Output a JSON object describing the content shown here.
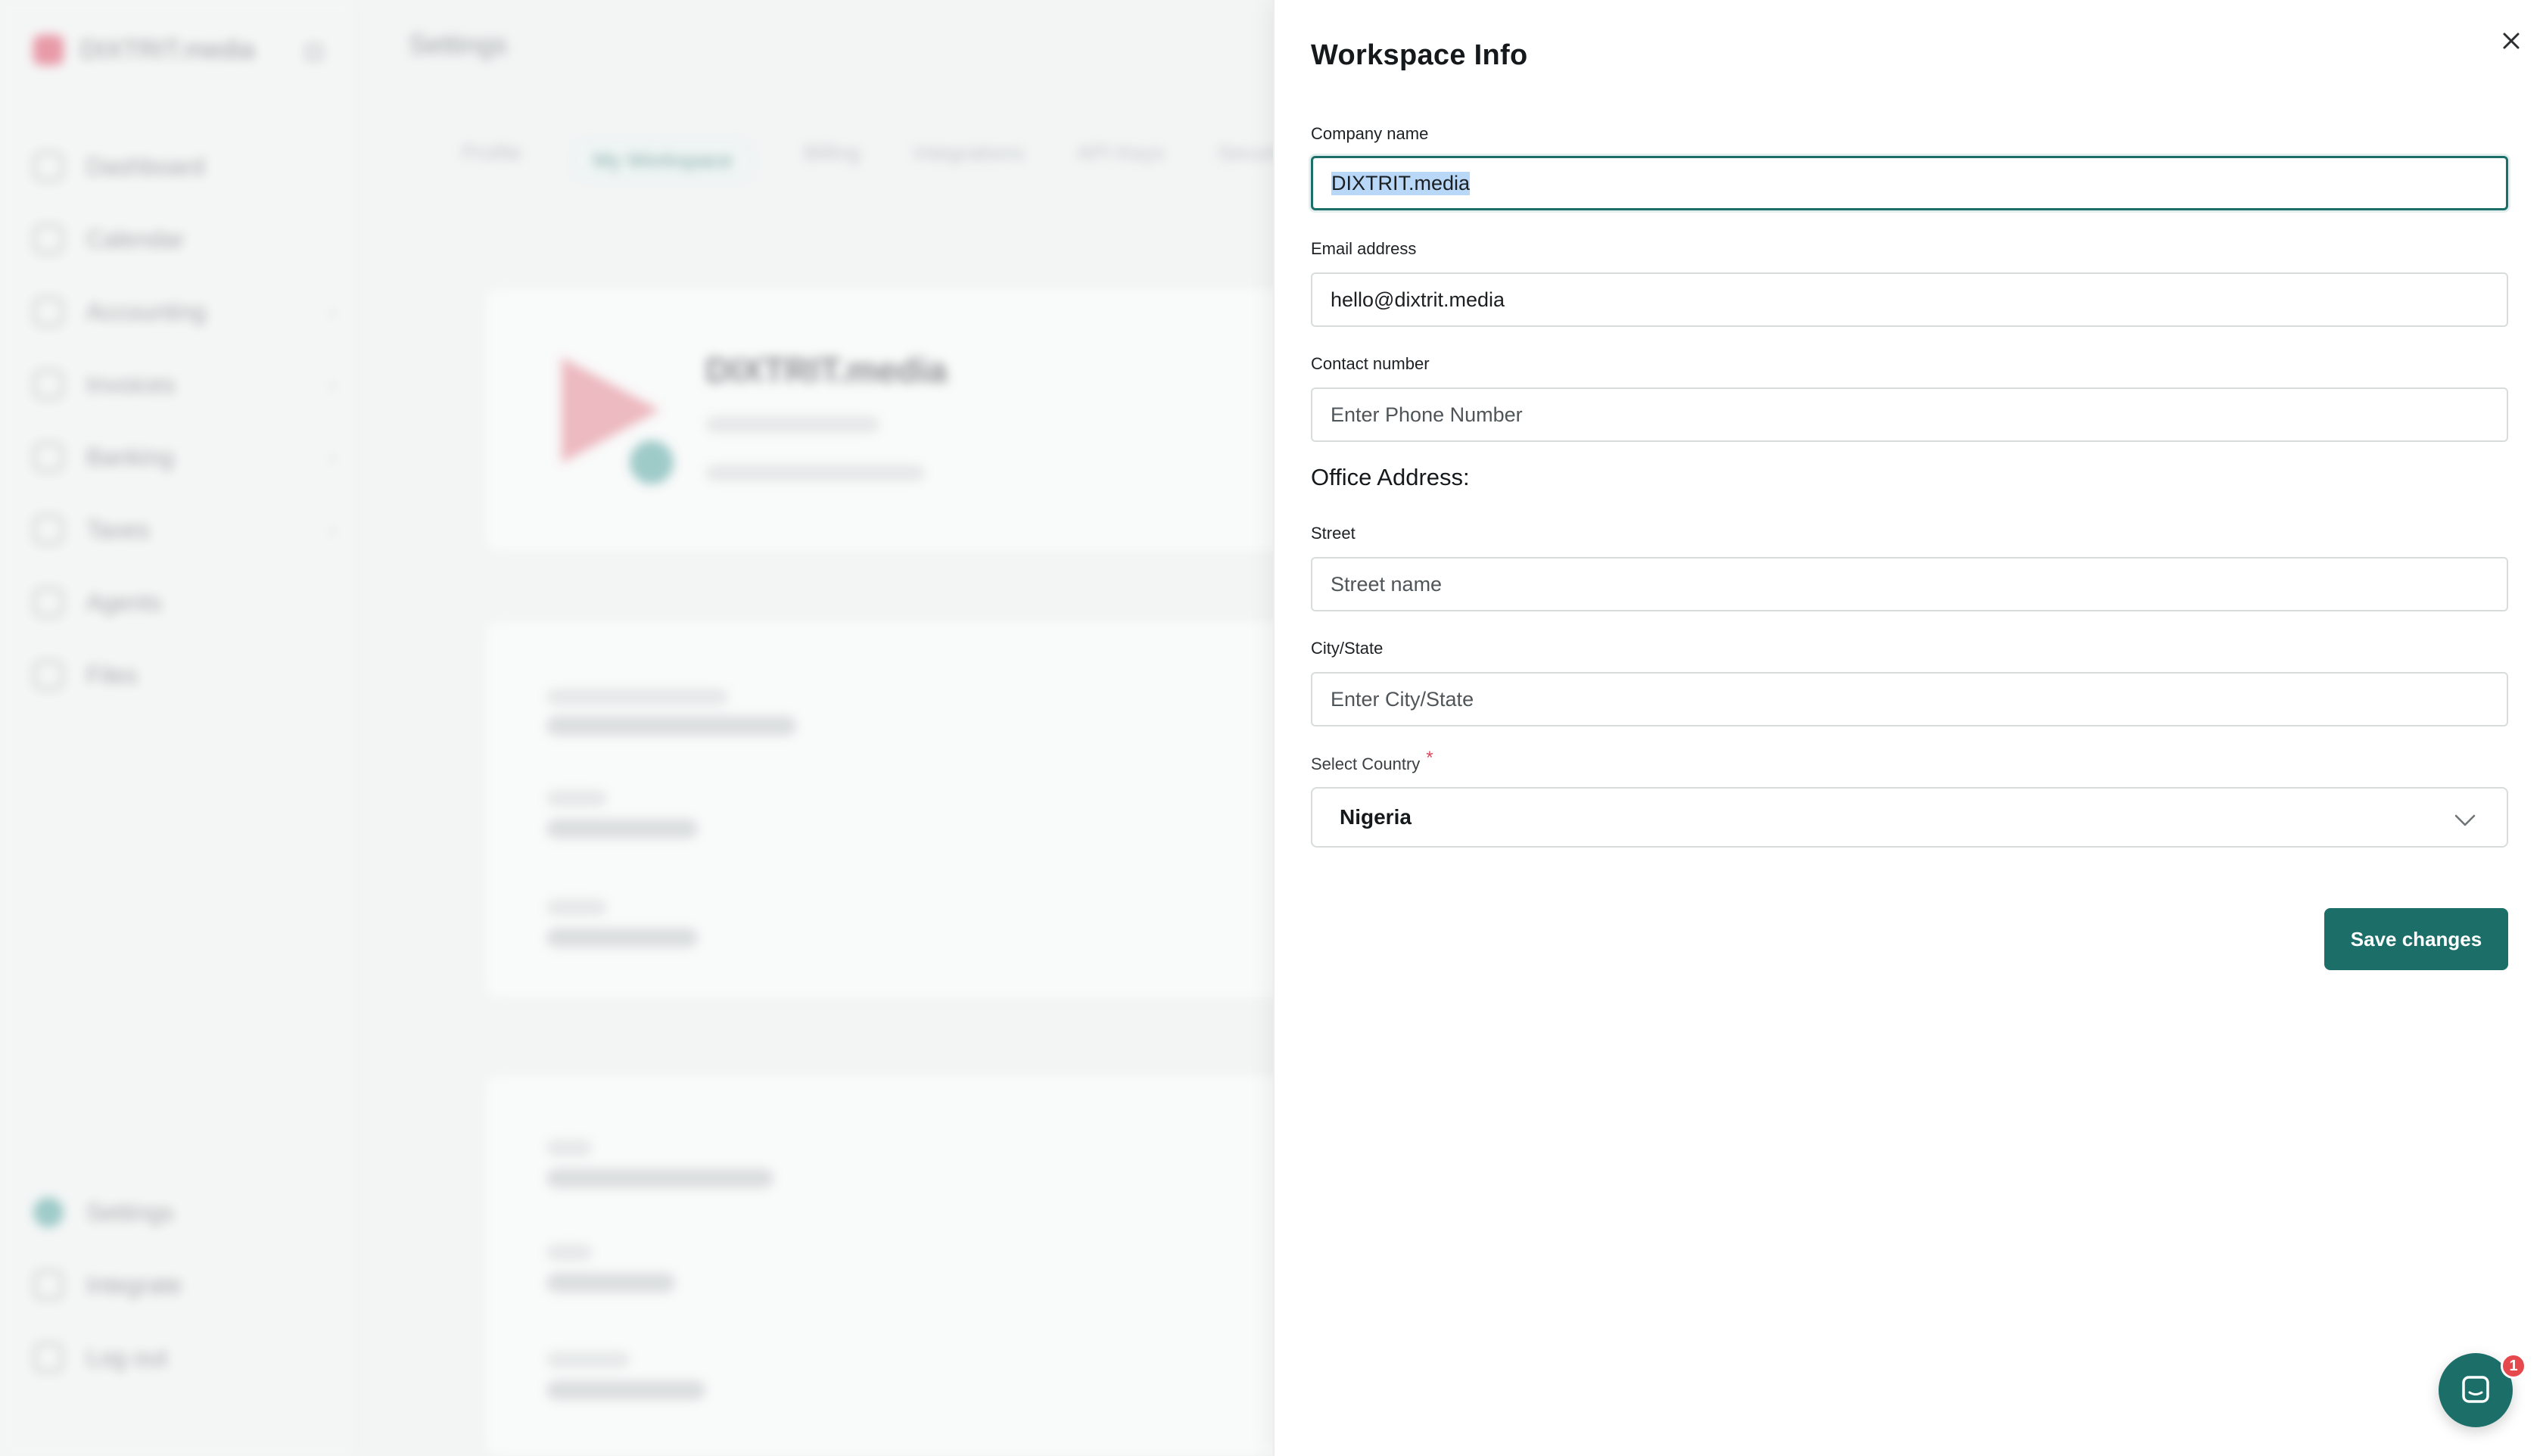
{
  "background": {
    "brand": "DIXTRIT.media",
    "page_title": "Settings",
    "nav_items": [
      "Dashboard",
      "Calendar",
      "Accounting",
      "Invoices",
      "Banking",
      "Taxes",
      "Agents",
      "Files"
    ],
    "nav_bottom_items": [
      "Settings",
      "Integrate",
      "Log out"
    ],
    "tabs": [
      "Profile",
      "My Workspace",
      "Billing",
      "Integrations",
      "API Keys",
      "Security & Login"
    ],
    "company_name": "DIXTRIT.media"
  },
  "drawer": {
    "title": "Workspace Info",
    "company_name": {
      "label": "Company name",
      "value": "DIXTRIT.media"
    },
    "email": {
      "label": "Email address",
      "value": "hello@dixtrit.media"
    },
    "contact": {
      "label": "Contact number",
      "placeholder": "Enter Phone Number"
    },
    "office_address_heading": "Office Address:",
    "street": {
      "label": "Street",
      "placeholder": "Street name"
    },
    "city": {
      "label": "City/State",
      "placeholder": "Enter City/State"
    },
    "country": {
      "label": "Select Country",
      "required_mark": "*",
      "value": "Nigeria"
    },
    "save_label": "Save changes"
  },
  "chat": {
    "badge_count": "1"
  },
  "colors": {
    "primary": "#1c6e69",
    "required": "#e0475b",
    "badge": "#e5484d",
    "selection": "#b9d7f7"
  },
  "icons": {
    "close": "close-icon",
    "dropdown": "chevron-down-icon",
    "chat": "chat-icon"
  }
}
